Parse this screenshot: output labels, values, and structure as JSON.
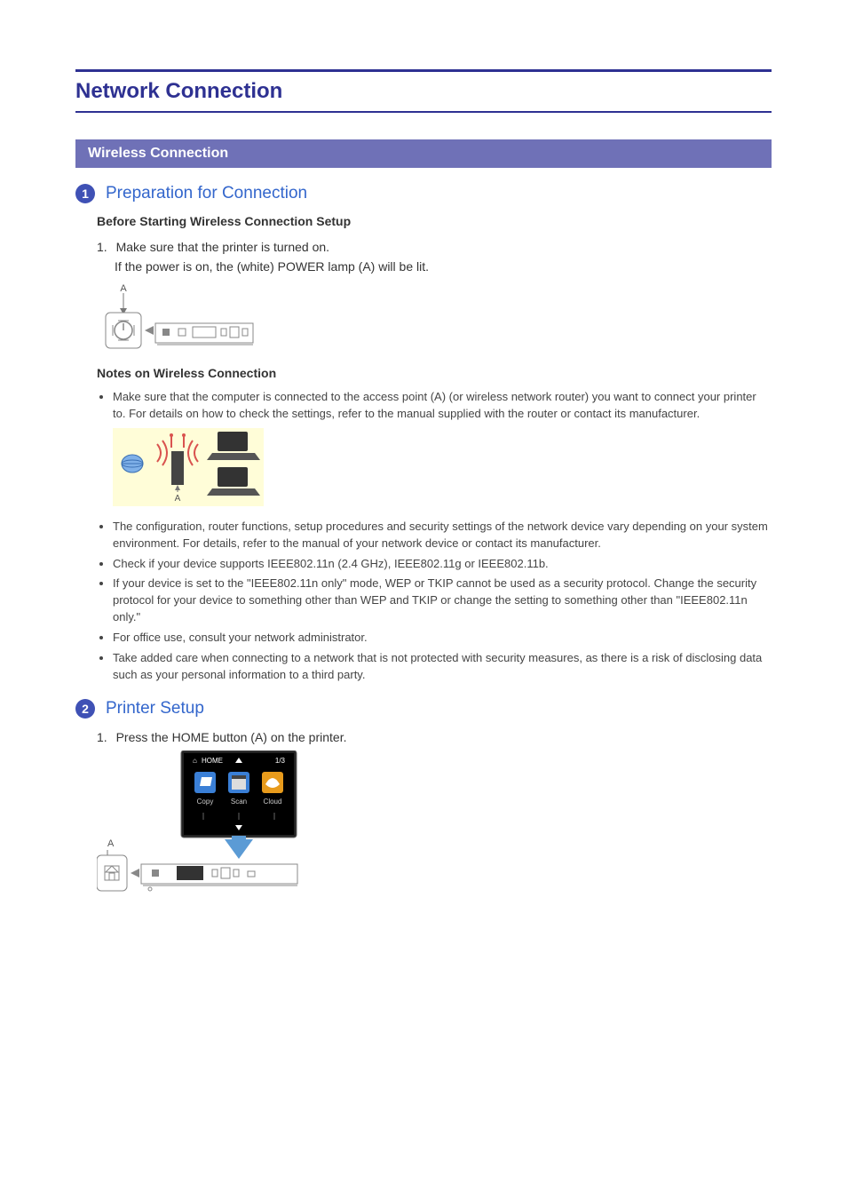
{
  "page": {
    "title": "Network Connection",
    "section_title": "Wireless Connection"
  },
  "section1": {
    "badge": "1",
    "heading": "Preparation for Connection",
    "before_title": "Before Starting Wireless Connection Setup",
    "step1_prefix": "1.",
    "step1_line1": "Make sure that the printer is turned on.",
    "step1_line2": "If the power is on, the (white) POWER lamp (A) will be lit.",
    "diagram_label": "A",
    "notes_title": "Notes on Wireless Connection",
    "bullets": [
      "Make sure that the computer is connected to the access point (A) (or wireless network router) you want to connect your printer to. For details on how to check the settings, refer to the manual supplied with the router or contact its manufacturer.",
      "The configuration, router functions, setup procedures and security settings of the network device vary depending on your system environment. For details, refer to the manual of your network device or contact its manufacturer.",
      "Check if your device supports IEEE802.11n (2.4 GHz), IEEE802.11g or IEEE802.11b.",
      "If your device is set to the \"IEEE802.11n only\" mode, WEP or TKIP cannot be used as a security protocol. Change the security protocol for your device to something other than WEP and TKIP or change the setting to something other than \"IEEE802.11n only.\"",
      "For office use, consult your network administrator.",
      "Take added care when connecting to a network that is not protected with security measures, as there is a risk of disclosing data such as your personal information to a third party."
    ],
    "network_diagram_label": "A"
  },
  "section2": {
    "badge": "2",
    "heading": "Printer Setup",
    "step1_prefix": "1.",
    "step1_text": "Press the HOME button (A) on the printer.",
    "screen": {
      "home_label": "HOME",
      "page_indicator": "1/3",
      "icons": [
        "Copy",
        "Scan",
        "Cloud"
      ]
    },
    "diagram_label": "A"
  }
}
